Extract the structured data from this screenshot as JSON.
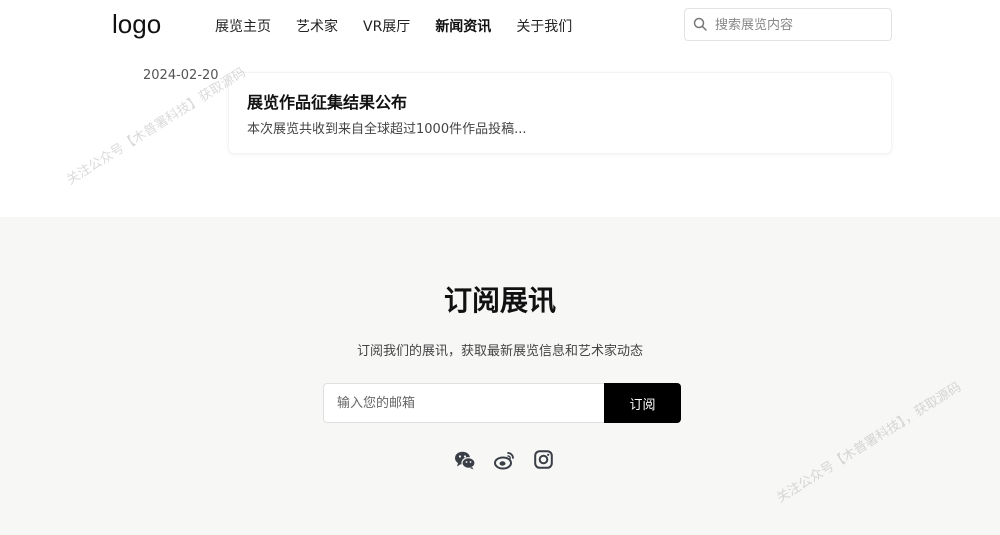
{
  "header": {
    "logo": "logo",
    "nav": [
      "展览主页",
      "艺术家",
      "VR展厅",
      "新闻资讯",
      "关于我们"
    ],
    "active_nav_index": 3,
    "search_placeholder": "搜索展览内容"
  },
  "news": {
    "date": "2024-02-20",
    "title": "展览作品征集结果公布",
    "summary": "本次展览共收到来自全球超过1000件作品投稿..."
  },
  "subscribe": {
    "title": "订阅展讯",
    "description": "订阅我们的展讯，获取最新展览信息和艺术家动态",
    "email_placeholder": "输入您的邮箱",
    "button_label": "订阅",
    "social_icons": [
      "wechat-icon",
      "weibo-icon",
      "instagram-icon"
    ]
  },
  "watermarks": [
    "关注公众号【木普署科技】获取源码",
    "关注公众号【木普署科技】，获取源码"
  ],
  "colors": {
    "button_bg": "#000000",
    "section_bg": "#f7f7f6",
    "text": "#111111"
  }
}
